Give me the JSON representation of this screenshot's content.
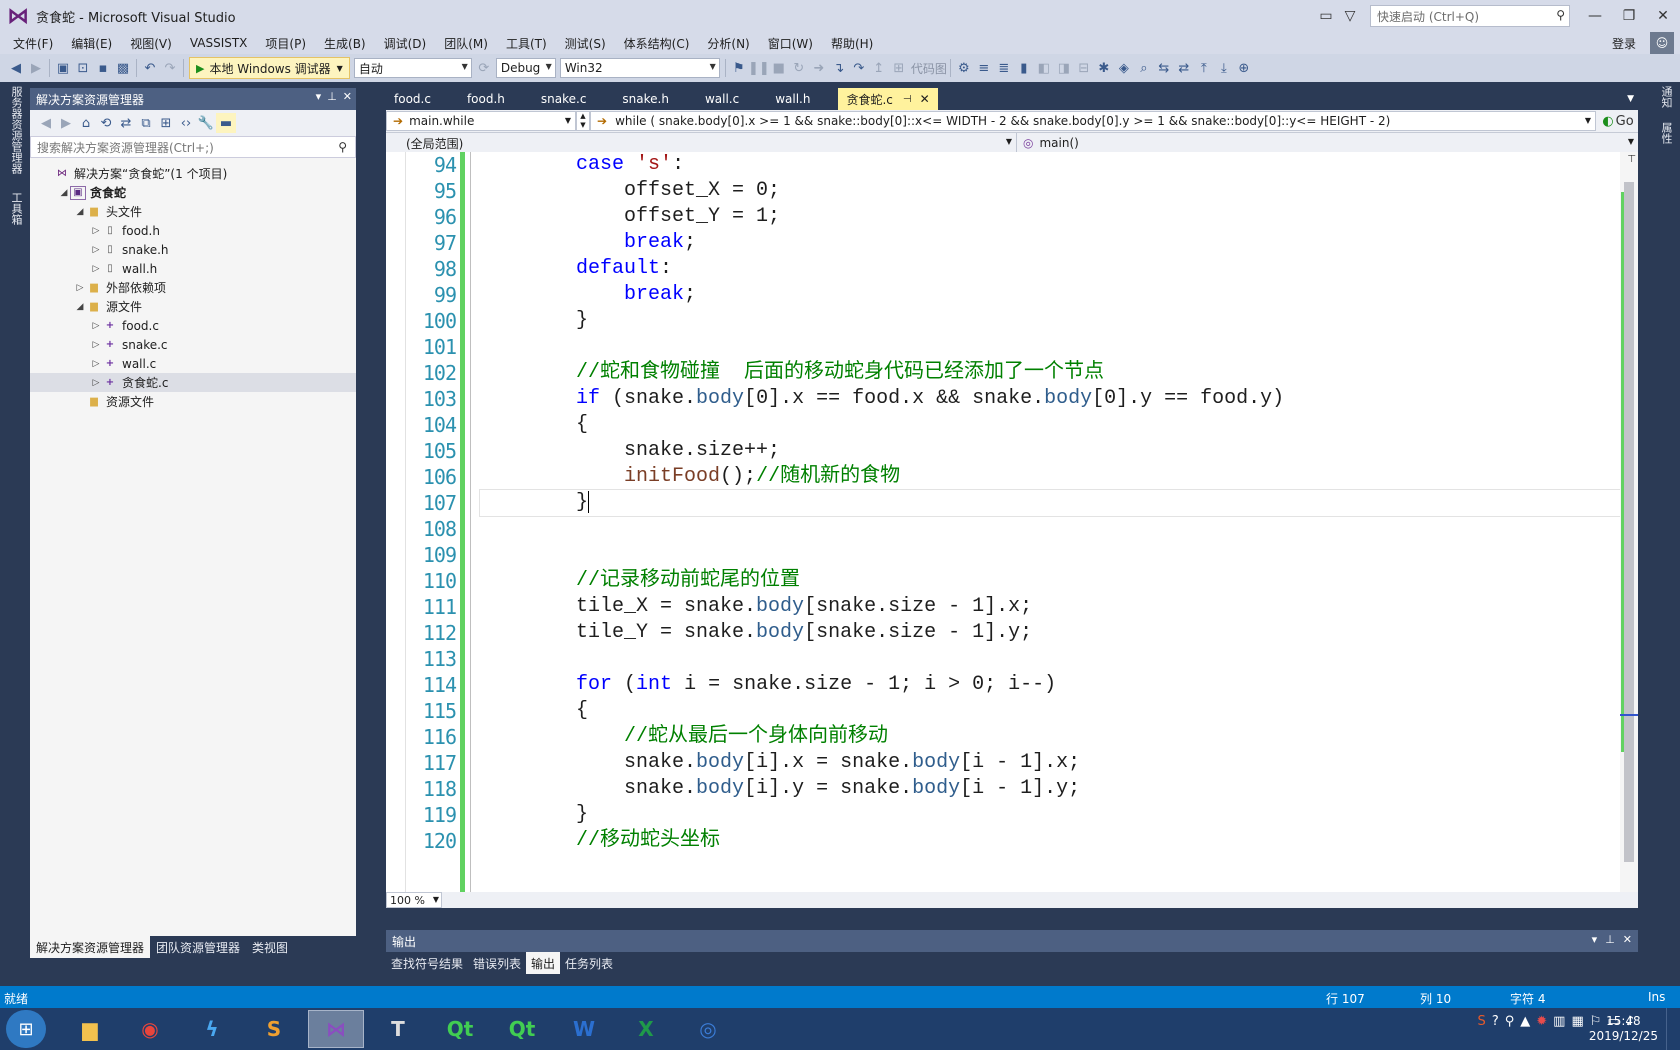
{
  "window": {
    "title": "贪食蛇 - Microsoft Visual Studio",
    "quick_launch_placeholder": "快速启动 (Ctrl+Q)",
    "minimize": "—",
    "restore": "❐",
    "close": "✕"
  },
  "menu": {
    "items": [
      "文件(F)",
      "编辑(E)",
      "视图(V)",
      "VASSISTX",
      "项目(P)",
      "生成(B)",
      "调试(D)",
      "团队(M)",
      "工具(T)",
      "测试(S)",
      "体系结构(C)",
      "分析(N)",
      "窗口(W)",
      "帮助(H)"
    ],
    "login": "登录"
  },
  "toolbar": {
    "run_label": "本地 Windows 调试器",
    "config_combo": "自动",
    "build_config": "Debug",
    "platform": "Win32",
    "codemap_label": "代码图"
  },
  "left_strip": {
    "tab1": "服务器资源管理器",
    "tab2": "工具箱"
  },
  "right_strip": {
    "tab1": "通知",
    "tab2": "属性"
  },
  "solution_explorer": {
    "header": "解决方案资源管理器",
    "search_placeholder": "搜索解决方案资源管理器(Ctrl+;)",
    "tree": [
      {
        "label": "解决方案“贪食蛇”(1 个项目)",
        "icon": "solution-icon",
        "level": 0,
        "expander": ""
      },
      {
        "label": "贪食蛇",
        "icon": "project-icon",
        "level": 1,
        "expander": "◢"
      },
      {
        "label": "头文件",
        "icon": "folder-icon",
        "level": 2,
        "expander": "◢"
      },
      {
        "label": "food.h",
        "icon": "header-file-icon",
        "level": 3,
        "expander": "▷"
      },
      {
        "label": "snake.h",
        "icon": "header-file-icon",
        "level": 3,
        "expander": "▷"
      },
      {
        "label": "wall.h",
        "icon": "header-file-icon",
        "level": 3,
        "expander": "▷"
      },
      {
        "label": "外部依赖项",
        "icon": "folder-icon",
        "level": 2,
        "expander": "▷"
      },
      {
        "label": "源文件",
        "icon": "folder-icon",
        "level": 2,
        "expander": "◢"
      },
      {
        "label": "food.c",
        "icon": "c-file-icon",
        "level": 3,
        "expander": "▷"
      },
      {
        "label": "snake.c",
        "icon": "c-file-icon",
        "level": 3,
        "expander": "▷"
      },
      {
        "label": "wall.c",
        "icon": "c-file-icon",
        "level": 3,
        "expander": "▷"
      },
      {
        "label": "贪食蛇.c",
        "icon": "c-file-icon",
        "level": 3,
        "expander": "▷",
        "selected": true
      },
      {
        "label": "资源文件",
        "icon": "folder-icon",
        "level": 2,
        "expander": ""
      }
    ],
    "bottom_tabs": [
      "解决方案资源管理器",
      "团队资源管理器",
      "类视图"
    ]
  },
  "editor": {
    "tabs": [
      {
        "label": "food.c",
        "active": false
      },
      {
        "label": "food.h",
        "active": false
      },
      {
        "label": "snake.c",
        "active": false
      },
      {
        "label": "snake.h",
        "active": false
      },
      {
        "label": "wall.c",
        "active": false
      },
      {
        "label": "wall.h",
        "active": false
      },
      {
        "label": "贪食蛇.c",
        "active": true
      }
    ],
    "nav_left": "main.while",
    "nav_right": "while ( snake.body[0].x >= 1 && snake::body[0]::x<= WIDTH - 2 && snake.body[0].y >= 1 && snake::body[0]::y<= HEIGHT - 2)",
    "go_label": "Go",
    "scope_left": "(全局范围)",
    "scope_right": "main()",
    "zoom": "100 %",
    "line_numbers": [
      "94",
      "95",
      "96",
      "97",
      "98",
      "99",
      "100",
      "101",
      "102",
      "103",
      "104",
      "105",
      "106",
      "107",
      "108",
      "109",
      "110",
      "111",
      "112",
      "113",
      "114",
      "115",
      "116",
      "117",
      "118",
      "119",
      "120"
    ],
    "current_line": "107",
    "code": [
      "        case 's':",
      "            offset_X = 0;",
      "            offset_Y = 1;",
      "            break;",
      "        default:",
      "            break;",
      "        }",
      "",
      "        //蛇和食物碰撞  后面的移动蛇身代码已经添加了一个节点",
      "        if (snake.body[0].x == food.x && snake.body[0].y == food.y)",
      "        {",
      "            snake.size++;",
      "            initFood();//随机新的食物",
      "        }",
      "",
      "",
      "        //记录移动前蛇尾的位置",
      "        tile_X = snake.body[snake.size - 1].x;",
      "        tile_Y = snake.body[snake.size - 1].y;",
      "",
      "        for (int i = snake.size - 1; i > 0; i--)",
      "        {",
      "            //蛇从最后一个身体向前移动",
      "            snake.body[i].x = snake.body[i - 1].x;",
      "            snake.body[i].y = snake.body[i - 1].y;",
      "        }",
      "        //移动蛇头坐标"
    ]
  },
  "output": {
    "header": "输出",
    "tabs": [
      "查找符号结果",
      "错误列表",
      "输出",
      "任务列表"
    ],
    "active_tab": "输出"
  },
  "status": {
    "text": "就绪",
    "line": "行 107",
    "col": "列 10",
    "char": "字符 4",
    "mode": "Ins"
  },
  "taskbar": {
    "time": "15:48",
    "date": "2019/12/25",
    "apps": [
      "file-explorer-icon",
      "chrome-icon",
      "thunder-icon",
      "sublime-icon",
      "visual-studio-icon",
      "typora-icon",
      "qt-creator-icon",
      "qt-designer-icon",
      "word-icon",
      "excel-icon",
      "teamviewer-icon"
    ],
    "active_app": "visual-studio-icon"
  }
}
